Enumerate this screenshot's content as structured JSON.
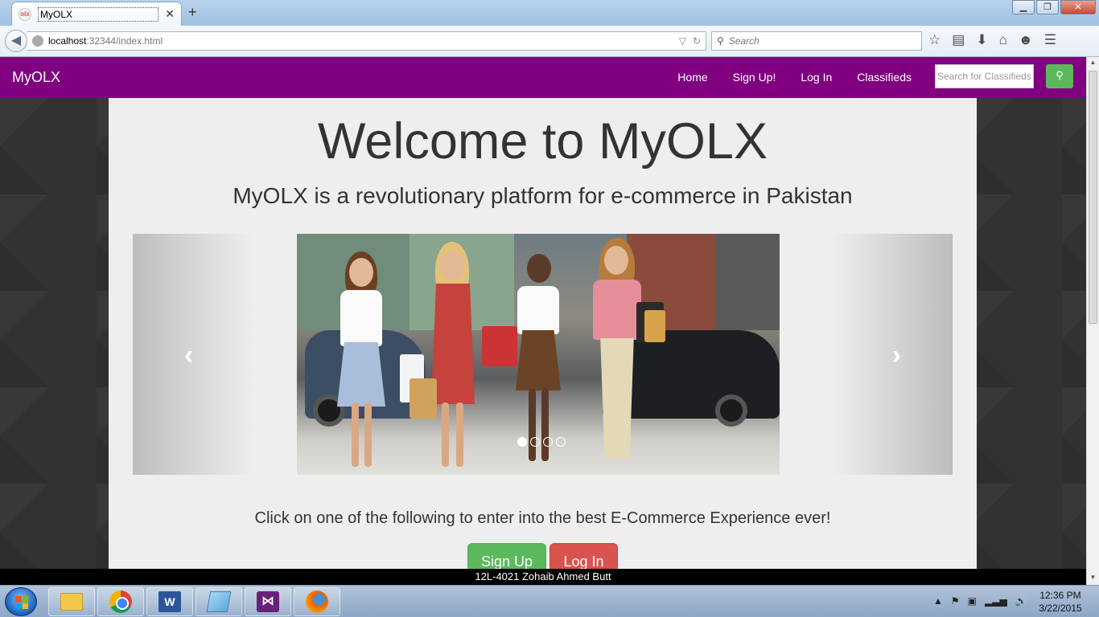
{
  "browser": {
    "tab_title": "MyOLX",
    "favicon_text": "olx",
    "new_tab": "+",
    "url_host": "localhost",
    "url_rest": ":32344/index.html",
    "search_placeholder": "Search"
  },
  "site": {
    "brand": "MyOLX",
    "nav": [
      "Home",
      "Sign Up!",
      "Log In",
      "Classifieds"
    ],
    "search_placeholder": "Search for Classifieds",
    "heading": "Welcome to MyOLX",
    "subheading": "MyOLX is a revolutionary platform for e-commerce in Pakistan",
    "carousel": {
      "slides": 4,
      "active_index": 0
    },
    "cta_text": "Click on one of the following to enter into the best E-Commerce Experience ever!",
    "signup_button": "Sign Up",
    "login_button": "Log In",
    "footer_caption": "12L-4021 Zohaib Ahmed Butt"
  },
  "taskbar": {
    "apps": [
      "explorer-icon",
      "chrome-icon",
      "word-icon",
      "tablet-icon",
      "visual-studio-icon",
      "firefox-icon"
    ],
    "word_letter": "W",
    "time": "12:36 PM",
    "date": "3/22/2015"
  },
  "colors": {
    "navbar": "#800080",
    "success": "#5cb85c",
    "danger": "#d9534f"
  }
}
